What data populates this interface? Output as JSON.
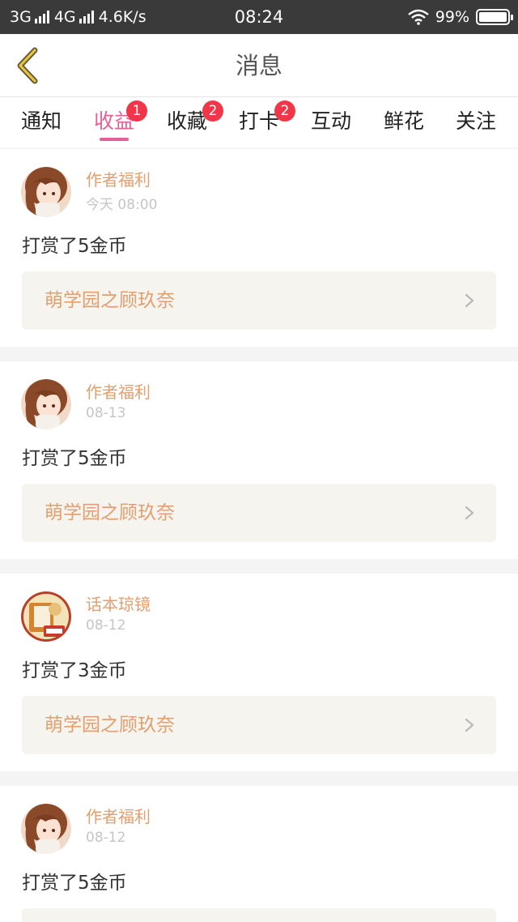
{
  "status_bar": {
    "net1": "3G",
    "net2": "4G",
    "speed": "4.6K/s",
    "time": "08:24",
    "battery": "99%",
    "battery_level": 0.99
  },
  "header": {
    "title": "消息"
  },
  "tabs": [
    {
      "label": "通知",
      "badge": ""
    },
    {
      "label": "收益",
      "badge": "1"
    },
    {
      "label": "收藏",
      "badge": "2"
    },
    {
      "label": "打卡",
      "badge": "2"
    },
    {
      "label": "互动",
      "badge": ""
    },
    {
      "label": "鲜花",
      "badge": ""
    },
    {
      "label": "关注",
      "badge": ""
    }
  ],
  "active_tab": 1,
  "messages": [
    {
      "author": "作者福利",
      "time": "今天 08:00",
      "text": "打赏了5金币",
      "book": "萌学园之顾玖奈",
      "avatar": "anime-girl-avatar"
    },
    {
      "author": "作者福利",
      "time": "08-13",
      "text": "打赏了5金币",
      "book": "萌学园之顾玖奈",
      "avatar": "anime-girl-avatar"
    },
    {
      "author": "话本琼镜",
      "time": "08-12",
      "text": "打赏了3金币",
      "book": "萌学园之顾玖奈",
      "avatar": "book-logo-avatar"
    },
    {
      "author": "作者福利",
      "time": "08-12",
      "text": "打赏了5金币",
      "book": "",
      "avatar": "anime-girl-avatar"
    }
  ],
  "colors": {
    "accent": "#e55f98",
    "author": "#e39f6f",
    "badge": "#f0374a"
  }
}
